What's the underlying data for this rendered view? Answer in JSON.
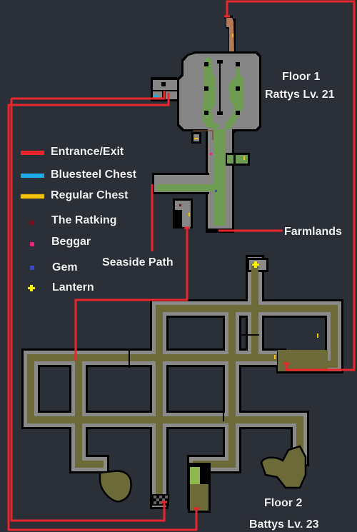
{
  "colors": {
    "background": "#2b2f38",
    "entrance_exit": "#e8262b",
    "bluesteel_chest": "#1ea9e8",
    "regular_chest": "#f4c20d",
    "ratking": "#7a0c14",
    "beggar": "#e8237a",
    "gem": "#3b48c8",
    "lantern": "#fff200",
    "floor1_wall": "#858585",
    "floor1_grass": "#6e9c52",
    "floor1_dirt": "#b47a55",
    "floor2_floor": "#6b6a38",
    "floor2_wall": "#8a8a8a",
    "floor2_moss": "#8fb64f",
    "outline": "#000000"
  },
  "legend": [
    {
      "key": "entrance_exit",
      "label": "Entrance/Exit",
      "marker": "bar"
    },
    {
      "key": "bluesteel_chest",
      "label": "Bluesteel Chest",
      "marker": "bar"
    },
    {
      "key": "regular_chest",
      "label": "Regular Chest",
      "marker": "bar"
    },
    {
      "key": "ratking",
      "label": "The Ratking",
      "marker": "square"
    },
    {
      "key": "beggar",
      "label": "Beggar",
      "marker": "square"
    },
    {
      "key": "gem",
      "label": "Gem",
      "marker": "square"
    },
    {
      "key": "lantern",
      "label": "Lantern",
      "marker": "cross"
    }
  ],
  "floors": [
    {
      "title": "Floor 1",
      "subtitle": "Rattys Lv. 21"
    },
    {
      "title": "Floor 2",
      "subtitle": "Battys Lv. 23"
    }
  ],
  "exits": {
    "farmlands": "Farmlands",
    "seaside_path": "Seaside Path"
  }
}
